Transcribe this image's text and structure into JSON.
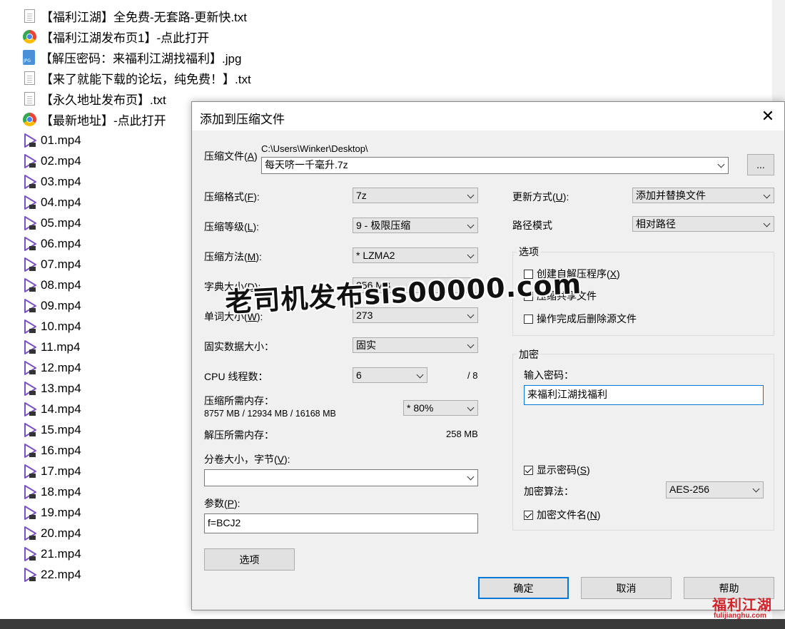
{
  "explorer": {
    "files": [
      {
        "name": "【福利江湖】全免费-无套路-更新快.txt",
        "icon": "text-file-icon"
      },
      {
        "name": "【福利江湖发布页1】-点此打开",
        "icon": "chrome-link-icon"
      },
      {
        "name": "【解压密码：来福利江湖找福利】.jpg",
        "icon": "jpg-file-icon"
      },
      {
        "name": "【来了就能下载的论坛，纯免费！】.txt",
        "icon": "text-file-icon"
      },
      {
        "name": "【永久地址发布页】.txt",
        "icon": "text-file-icon"
      },
      {
        "name": "【最新地址】-点此打开",
        "icon": "chrome-link-icon"
      },
      {
        "name": "01.mp4",
        "icon": "video-file-icon"
      },
      {
        "name": "02.mp4",
        "icon": "video-file-icon"
      },
      {
        "name": "03.mp4",
        "icon": "video-file-icon"
      },
      {
        "name": "04.mp4",
        "icon": "video-file-icon"
      },
      {
        "name": "05.mp4",
        "icon": "video-file-icon"
      },
      {
        "name": "06.mp4",
        "icon": "video-file-icon"
      },
      {
        "name": "07.mp4",
        "icon": "video-file-icon"
      },
      {
        "name": "08.mp4",
        "icon": "video-file-icon"
      },
      {
        "name": "09.mp4",
        "icon": "video-file-icon"
      },
      {
        "name": "10.mp4",
        "icon": "video-file-icon"
      },
      {
        "name": "11.mp4",
        "icon": "video-file-icon"
      },
      {
        "name": "12.mp4",
        "icon": "video-file-icon"
      },
      {
        "name": "13.mp4",
        "icon": "video-file-icon"
      },
      {
        "name": "14.mp4",
        "icon": "video-file-icon"
      },
      {
        "name": "15.mp4",
        "icon": "video-file-icon"
      },
      {
        "name": "16.mp4",
        "icon": "video-file-icon"
      },
      {
        "name": "17.mp4",
        "icon": "video-file-icon"
      },
      {
        "name": "18.mp4",
        "icon": "video-file-icon"
      },
      {
        "name": "19.mp4",
        "icon": "video-file-icon"
      },
      {
        "name": "20.mp4",
        "icon": "video-file-icon"
      },
      {
        "name": "21.mp4",
        "icon": "video-file-icon"
      },
      {
        "name": "22.mp4",
        "icon": "video-file-icon"
      }
    ]
  },
  "dialog": {
    "title": "添加到压缩文件",
    "close_glyph": "✕",
    "archive": {
      "label": "压缩文件",
      "accel": "A",
      "path": "C:\\Users\\Winker\\Desktop\\",
      "filename": "每天哜一千毫升.7z",
      "browse_label": "..."
    },
    "format": {
      "label": "压缩格式",
      "accel": "F",
      "value": "7z"
    },
    "level": {
      "label": "压缩等级",
      "accel": "L",
      "value": "9 - 极限压缩"
    },
    "method": {
      "label": "压缩方法",
      "accel": "M",
      "value": "* LZMA2"
    },
    "dict": {
      "label": "字典大小",
      "accel": "D",
      "value": "256 MB"
    },
    "word": {
      "label": "单词大小",
      "accel": "W",
      "value": "273"
    },
    "solid": {
      "label": "固实数据大小：",
      "value": "固实"
    },
    "cpu": {
      "label": "CPU 线程数：",
      "value": "6",
      "total": "/ 8"
    },
    "mem_compress": {
      "label": "压缩所需内存：",
      "detail": "8757 MB / 12934 MB / 16168 MB",
      "value": "* 80%"
    },
    "mem_decompress": {
      "label": "解压所需内存：",
      "value": "258 MB"
    },
    "volume": {
      "label": "分卷大小，字节",
      "accel": "V",
      "value": ""
    },
    "params": {
      "label": "参数",
      "accel": "P",
      "value": "f=BCJ2"
    },
    "options_button": "选项",
    "update": {
      "label": "更新方式",
      "accel": "U",
      "value": "添加并替换文件"
    },
    "pathmode": {
      "label": "路径模式",
      "value": "相对路径"
    },
    "options_group": {
      "title": "选项",
      "sfx": {
        "label": "创建自解压程序",
        "accel": "X",
        "checked": false
      },
      "shared": {
        "label": "压缩共享文件",
        "checked": false
      },
      "delete": {
        "label": "操作完成后删除源文件",
        "checked": false
      }
    },
    "encryption": {
      "title": "加密",
      "pw_label": "输入密码：",
      "password": "来福利江湖找福利",
      "show_pw": {
        "label": "显示密码",
        "accel": "S",
        "checked": true
      },
      "algo_label": "加密算法：",
      "algo": "AES-256",
      "encrypt_names": {
        "label": "加密文件名",
        "accel": "N",
        "checked": true
      }
    },
    "buttons": {
      "ok": "确定",
      "cancel": "取消",
      "help": "帮助"
    }
  },
  "watermark": "老司机发布sis00000.com",
  "logo": {
    "text_cn": "福利江湖",
    "url": "fulijianghu.com"
  },
  "colors": {
    "accent": "#0078d7",
    "logo": "#d0232a",
    "video_icon": "#7b52c6"
  }
}
